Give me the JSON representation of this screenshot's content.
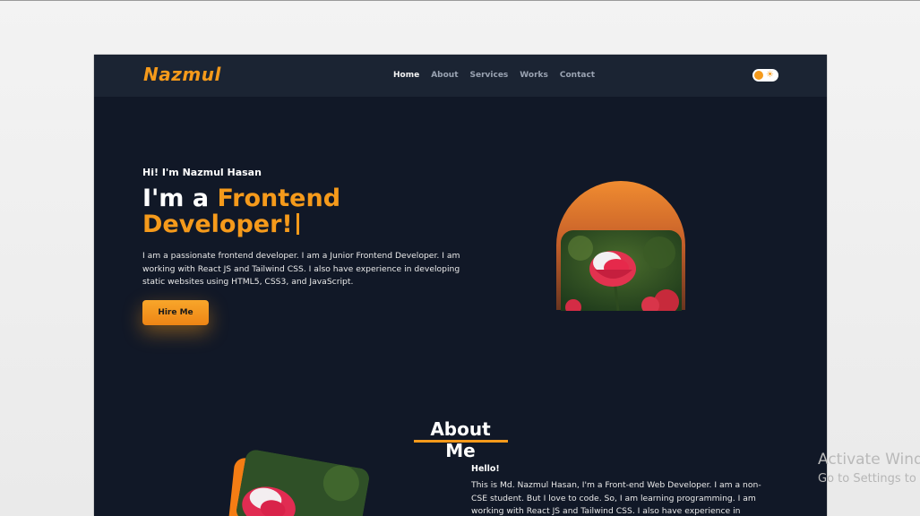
{
  "brand": {
    "name": "Nazmul",
    "accent": "#f59a1b",
    "background": "#111827",
    "navbar_bg": "#1b2433"
  },
  "nav": {
    "items": [
      {
        "label": "Home",
        "active": true
      },
      {
        "label": "About",
        "active": false
      },
      {
        "label": "Services",
        "active": false
      },
      {
        "label": "Works",
        "active": false
      },
      {
        "label": "Contact",
        "active": false
      }
    ],
    "theme_toggle_icon": "sun-icon"
  },
  "hero": {
    "greeting": "Hi! I'm Nazmul Hasan",
    "headline_prefix": "I'm a ",
    "headline_accent_1": "Frontend",
    "headline_accent_2": "Developer!",
    "intro": "I am a passionate frontend developer. I am a Junior Frontend Developer. I am working with React JS and Tailwind CSS. I also have experience in developing static websites using HTML5, CSS3, and JavaScript.",
    "cta_label": "Hire Me",
    "image_icon": "rose-photo"
  },
  "about": {
    "title": "About Me",
    "hello": "Hello!",
    "text": "This is Md. Nazmul Hasan, I'm a Front-end Web Developer. I am a non-CSE student. But I love to code. So, I am learning programming. I am working with React JS and Tailwind CSS. I also have experience in",
    "image_icon": "rose-photo"
  },
  "os_watermark": {
    "title": "Activate Wind",
    "subtitle": "Go to Settings to"
  }
}
